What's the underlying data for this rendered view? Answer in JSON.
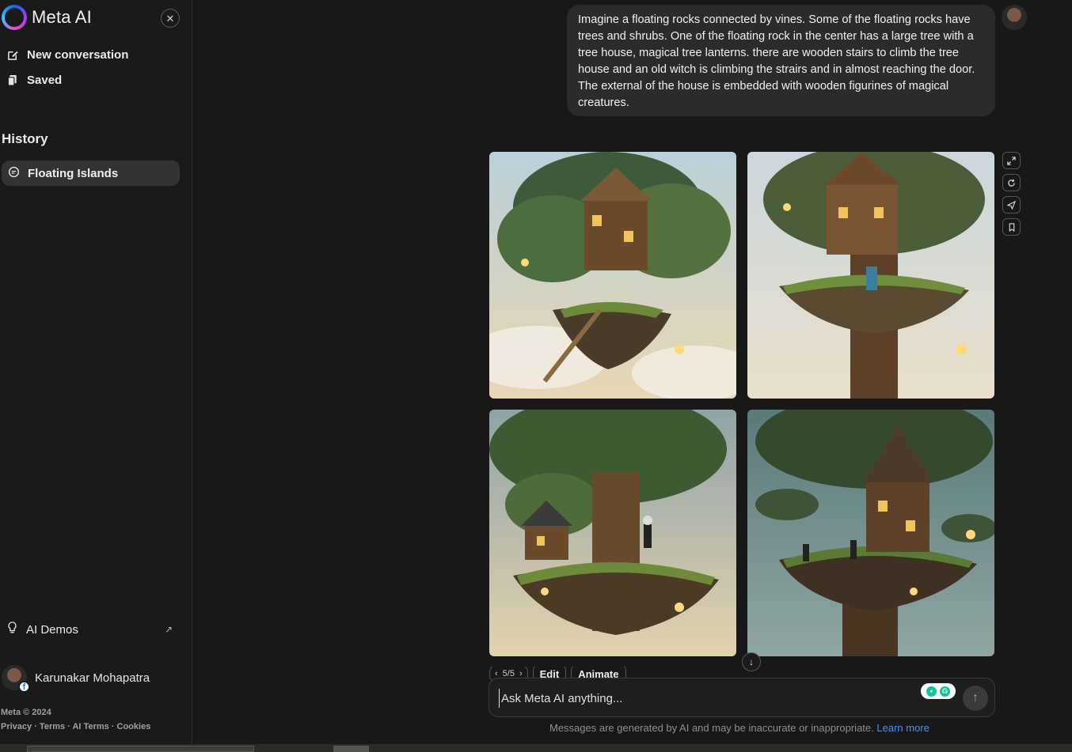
{
  "app": {
    "title": "Meta AI"
  },
  "sidebar": {
    "close_label": "✕",
    "new_conversation": "New conversation",
    "saved": "Saved",
    "history_title": "History",
    "history_items": [
      {
        "label": "Floating Islands"
      }
    ],
    "ai_demos": "AI Demos",
    "ai_demos_arrow": "↗",
    "user_name": "Karunakar Mohapatra",
    "footer_copyright": "Meta © 2024",
    "footer_links": "Privacy · Terms · AI Terms · Cookies"
  },
  "chat": {
    "user_message": "Imagine a floating rocks connected by vines. Some of the floating rocks have trees and shrubs. One of the floating rock in the center has a large tree with a tree house, magical tree lanterns. there are wooden stairs to climb the tree house and an old witch is climbing the strairs and in almost reaching the door. The external of the house is embedded with wooden figurines of magical creatures.",
    "pager": "5/5",
    "edit_label": "Edit",
    "animate_label": "Animate"
  },
  "composer": {
    "placeholder": "Ask Meta AI anything...",
    "value": ""
  },
  "disclaimer": {
    "text": "Messages are generated by AI and may be inaccurate or inappropriate.",
    "link": "Learn more"
  },
  "colors": {
    "background": "#181818",
    "sidebar": "#1a1a1a",
    "bubble": "#2b2b2b",
    "accent_link": "#4f8ef7"
  }
}
